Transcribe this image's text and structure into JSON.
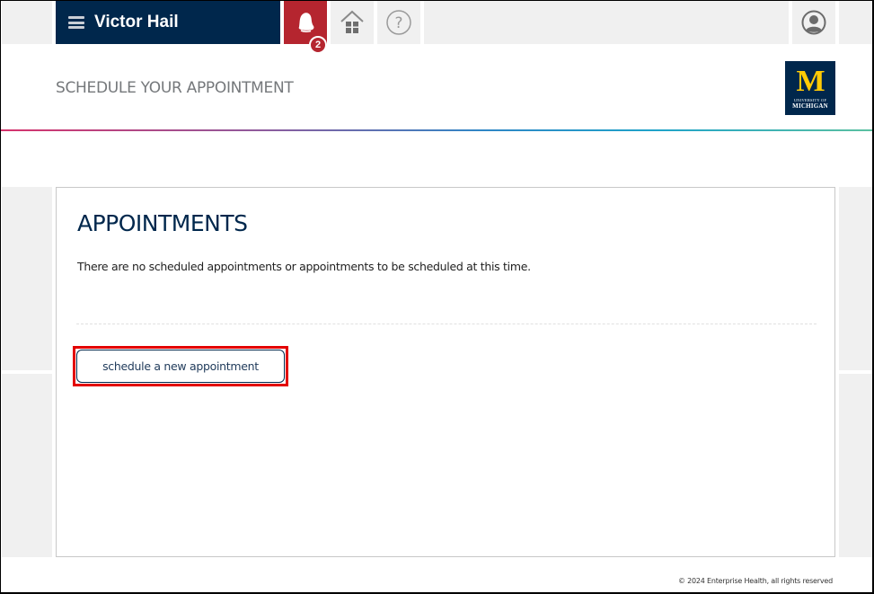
{
  "topbar": {
    "user_name": "Victor Hail",
    "menu_icon": "hamburger-menu-icon",
    "notifications": {
      "icon": "bell-icon",
      "count": "2"
    },
    "home_icon": "home-icon",
    "help_icon": "help-question-icon",
    "profile_icon": "user-profile-icon"
  },
  "header": {
    "title": "SCHEDULE YOUR APPOINTMENT",
    "logo": {
      "letter": "M",
      "line1": "UNIVERSITY OF",
      "line2": "MICHIGAN"
    }
  },
  "appointments": {
    "heading": "APPOINTMENTS",
    "message": "There are no scheduled appointments or appointments to be scheduled at this time.",
    "schedule_button_label": "schedule a new appointment"
  },
  "footer": {
    "copyright": "© 2024 Enterprise Health, all rights reserved"
  },
  "colors": {
    "navy": "#00274c",
    "notification_red": "#b5252f",
    "maize": "#ffcb05",
    "highlight_red": "#e30000"
  }
}
